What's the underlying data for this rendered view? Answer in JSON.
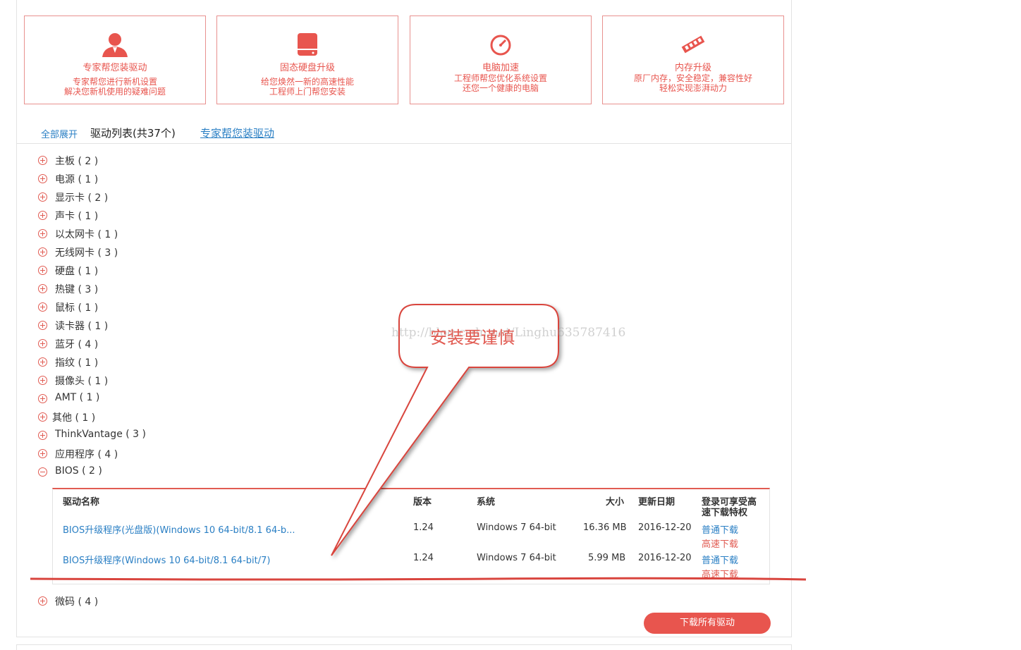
{
  "services": [
    {
      "icon": "person-icon",
      "title": "专家帮您装驱动",
      "line1": "专家帮您进行新机设置",
      "line2": "解决您新机使用的疑难问题"
    },
    {
      "icon": "hard-drive-icon",
      "title": "固态硬盘升级",
      "line1": "给您焕然一新的高速性能",
      "line2": "工程师上门帮您安装"
    },
    {
      "icon": "speedometer-icon",
      "title": "电脑加速",
      "line1": "工程师帮您优化系统设置",
      "line2": "还您一个健康的电脑"
    },
    {
      "icon": "memory-stick-icon",
      "title": "内存升级",
      "line1": "原厂内存，安全稳定，兼容性好",
      "line2": "轻松实现澎湃动力"
    }
  ],
  "toolbar": {
    "expand_all": "全部展开",
    "list_title": "驱动列表(共37个)",
    "expert_link": "专家帮您装驱动"
  },
  "categories": [
    "主板 ( 2 )",
    "电源 ( 1 )",
    "显示卡 ( 2 )",
    "声卡 ( 1 )",
    "以太网卡 ( 1 )",
    "无线网卡 ( 3 )",
    "硬盘 ( 1 )",
    "热键 ( 3 )",
    "鼠标 ( 1 )",
    "读卡器 ( 1 )",
    "蓝牙 ( 4 )",
    "指纹 ( 1 )",
    "摄像头 ( 1 )",
    "AMT ( 1 )",
    "其他 ( 1 )",
    "ThinkVantage ( 3 )",
    "应用程序 ( 4 )",
    "BIOS ( 2 )"
  ],
  "after_category": "微码 ( 4 )",
  "table": {
    "headers": {
      "name": "驱动名称",
      "version": "版本",
      "os": "系统",
      "size": "大小",
      "date": "更新日期",
      "download": "登录可享受高速下载特权"
    },
    "rows": [
      {
        "name": "BIOS升级程序(光盘版)(Windows 10 64-bit/8.1 64-b...",
        "version": "1.24",
        "os": "Windows 7 64-bit",
        "size": "16.36 MB",
        "date": "2016-12-20",
        "normal": "普通下载",
        "fast": "高速下载"
      },
      {
        "name": "BIOS升级程序(Windows 10 64-bit/8.1 64-bit/7)",
        "version": "1.24",
        "os": "Windows 7 64-bit",
        "size": "5.99 MB",
        "date": "2016-12-20",
        "normal": "普通下载",
        "fast": "高速下载"
      }
    ]
  },
  "download_all": "下载所有驱动",
  "annotation": {
    "callout": "安装要谨慎",
    "watermark": "http://blog.csdn.net/Linghu635787416"
  },
  "colors": {
    "accent": "#e8554e",
    "link": "#2a7fc4",
    "border": "#e3e3e3"
  }
}
